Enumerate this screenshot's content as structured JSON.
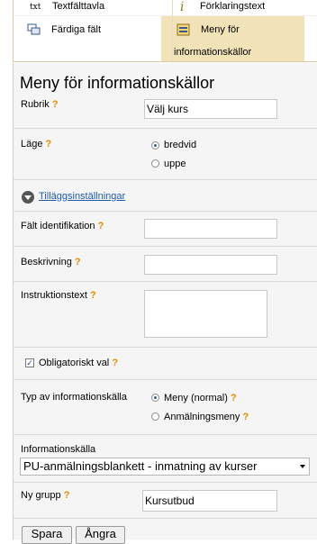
{
  "palette": {
    "items": [
      {
        "icon": "txt",
        "label": "Textfälttavla"
      },
      {
        "icon": "i",
        "label": "Förklaringstext"
      },
      {
        "icon": "grid-icon",
        "label": "Färdiga fält"
      },
      {
        "icon": "list-icon",
        "label_line1": "Meny för",
        "label_line2": "informationskällor"
      }
    ]
  },
  "form": {
    "title": "Meny för informationskällor",
    "q": "?",
    "rubrik_label": "Rubrik",
    "rubrik_value": "Välj kurs",
    "lage_label": "Läge",
    "lage_options": [
      "bredvid",
      "uppe"
    ],
    "advanced_link": "Tilläggsinställningar",
    "field_id_label": "Fält identifikation",
    "field_id_value": "",
    "description_label": "Beskrivning",
    "description_value": "",
    "instruction_label": "Instruktionstext",
    "instruction_value": "",
    "mandatory_label": "Obligatoriskt val",
    "mandatory_checked": "✓",
    "source_type_label": "Typ av informationskälla",
    "source_type_options": [
      "Meny (normal)",
      "Anmälningsmeny"
    ],
    "source_label": "Informationskälla",
    "source_value": "PU-anmälningsblankett - inmatning av kurser",
    "new_group_label": "Ny grupp",
    "new_group_value": "Kursutbud",
    "save_button": "Spara",
    "undo_button": "Ångra"
  }
}
